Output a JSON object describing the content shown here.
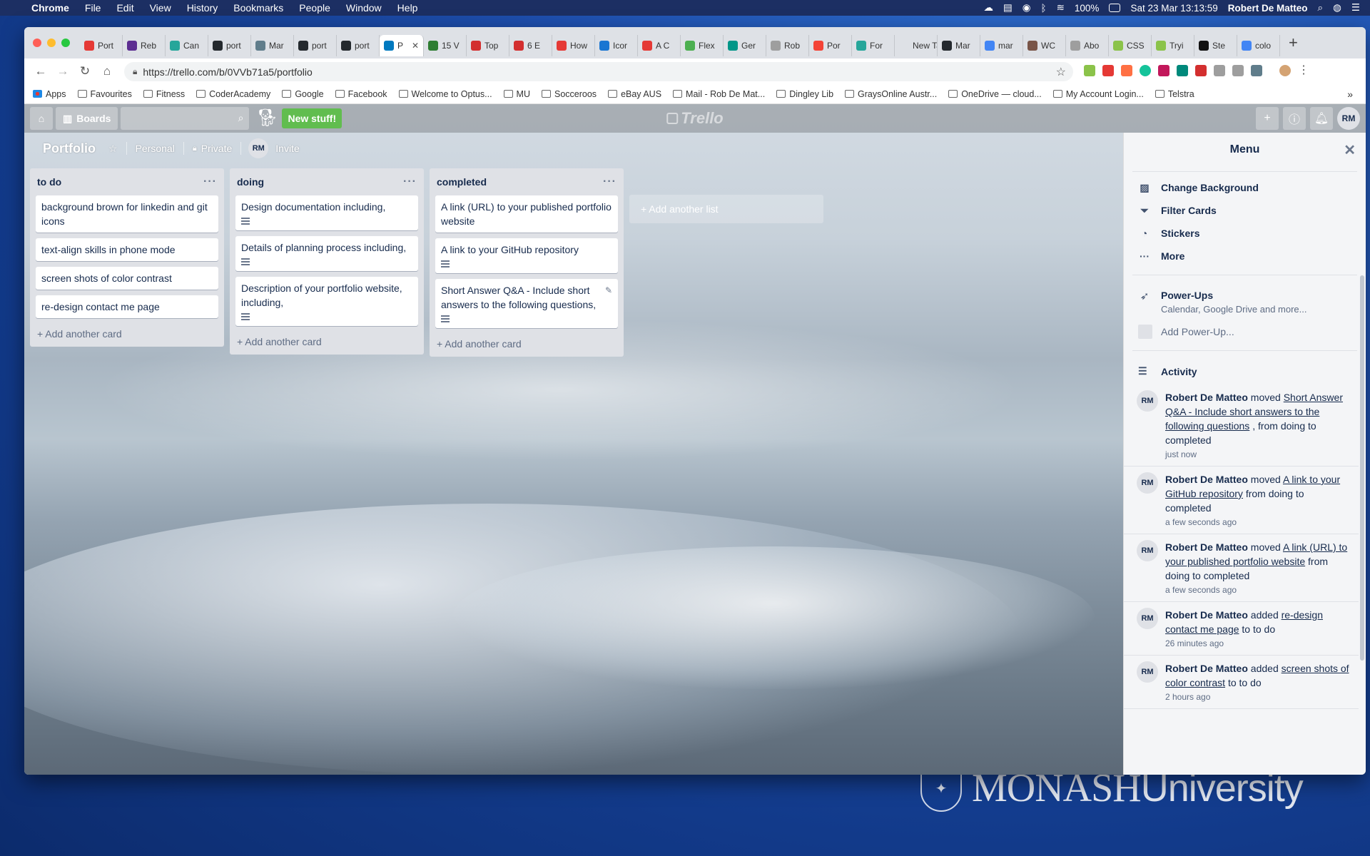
{
  "mac_menubar": {
    "app": "Chrome",
    "items": [
      "File",
      "Edit",
      "View",
      "History",
      "Bookmarks",
      "People",
      "Window",
      "Help"
    ],
    "battery": "100%",
    "datetime": "Sat 23 Mar  13:13:59",
    "user": "Robert De Matteo"
  },
  "tabs": [
    {
      "label": "Port",
      "color": "#e53935"
    },
    {
      "label": "Reb",
      "color": "#5c2d91"
    },
    {
      "label": "Can",
      "color": "#26a69a"
    },
    {
      "label": "port",
      "color": "#24292e"
    },
    {
      "label": "Mar",
      "color": "#607d8b"
    },
    {
      "label": "port",
      "color": "#24292e"
    },
    {
      "label": "port",
      "color": "#24292e"
    },
    {
      "label": "P",
      "color": "#0079bf",
      "active": true
    },
    {
      "label": "15 V",
      "color": "#2e7d32"
    },
    {
      "label": "Top",
      "color": "#d32f2f"
    },
    {
      "label": "6 E",
      "color": "#d32f2f"
    },
    {
      "label": "How",
      "color": "#e53935"
    },
    {
      "label": "Icor",
      "color": "#1976d2"
    },
    {
      "label": "A C",
      "color": "#e53935"
    },
    {
      "label": "Flex",
      "color": "#4caf50"
    },
    {
      "label": "Ger",
      "color": "#009688"
    },
    {
      "label": "Rob",
      "color": "#9e9e9e"
    },
    {
      "label": "Por",
      "color": "#f44336"
    },
    {
      "label": "For",
      "color": "#26a69a"
    },
    {
      "label": "New Tab",
      "color": "#dee1e6"
    },
    {
      "label": "Mar",
      "color": "#24292e"
    },
    {
      "label": "mar",
      "color": "#4285f4"
    },
    {
      "label": "WC",
      "color": "#795548"
    },
    {
      "label": "Abo",
      "color": "#9e9e9e"
    },
    {
      "label": "CSS",
      "color": "#8bc34a"
    },
    {
      "label": "Tryi",
      "color": "#8bc34a"
    },
    {
      "label": "Ste",
      "color": "#111111"
    },
    {
      "label": "colo",
      "color": "#4285f4"
    }
  ],
  "address": {
    "url": "https://trello.com/b/0VVb71a5/portfolio"
  },
  "bookmarks": [
    "Apps",
    "Favourites",
    "Fitness",
    "CoderAcademy",
    "Google",
    "Facebook",
    "Welcome to Optus...",
    "MU",
    "Socceroos",
    "eBay AUS",
    "Mail - Rob De Mat...",
    "Dingley Lib",
    "GraysOnline Austr...",
    "OneDrive — cloud...",
    "My Account Login...",
    "Telstra"
  ],
  "trello_header": {
    "boards": "Boards",
    "new_stuff": "New stuff!",
    "logo": "Trello",
    "avatar": "RM"
  },
  "board": {
    "title": "Portfolio",
    "visibility_team": "Personal",
    "visibility": "Private",
    "member": "RM",
    "invite": "Invite"
  },
  "lists": [
    {
      "title": "to do",
      "cards": [
        {
          "text": "background brown for linkedin and git icons",
          "desc": false
        },
        {
          "text": "text-align skills in phone mode",
          "desc": false
        },
        {
          "text": "screen shots of color contrast",
          "desc": false
        },
        {
          "text": "re-design contact me page",
          "desc": false
        }
      ],
      "add": "+ Add another card"
    },
    {
      "title": "doing",
      "cards": [
        {
          "text": "Design documentation including,",
          "desc": true
        },
        {
          "text": "Details of planning process including,",
          "desc": true
        },
        {
          "text": "Description of your portfolio website, including,",
          "desc": true
        }
      ],
      "add": "+ Add another card"
    },
    {
      "title": "completed",
      "cards": [
        {
          "text": "A link (URL) to your published portfolio website",
          "desc": false
        },
        {
          "text": "A link to your GitHub repository",
          "desc": true
        },
        {
          "text": "Short Answer Q&A - Include short answers to the following questions,",
          "desc": true,
          "edit": true
        }
      ],
      "add": "+ Add another card"
    }
  ],
  "add_list": "+ Add another list",
  "menu": {
    "title": "Menu",
    "items": [
      "Change Background",
      "Filter Cards",
      "Stickers",
      "More"
    ],
    "powerups_title": "Power-Ups",
    "powerups_sub": "Calendar, Google Drive and more...",
    "add_powerup": "Add Power-Up...",
    "activity_title": "Activity",
    "activity": [
      {
        "who": "Robert De Matteo",
        "pre": "moved",
        "link": "Short Answer Q&A - Include short answers to the following questions",
        "post": ", from doing to completed",
        "when": "just now"
      },
      {
        "who": "Robert De Matteo",
        "pre": "moved",
        "link": "A link to your GitHub repository",
        "post": "from doing to completed",
        "when": "a few seconds ago"
      },
      {
        "who": "Robert De Matteo",
        "pre": "moved",
        "link": "A link (URL) to your published portfolio website",
        "post": "from doing to completed",
        "when": "a few seconds ago"
      },
      {
        "who": "Robert De Matteo",
        "pre": "added",
        "link": "re-design contact me page",
        "post": "to to do",
        "when": "26 minutes ago"
      },
      {
        "who": "Robert De Matteo",
        "pre": "added",
        "link": "screen shots of color contrast",
        "post": "to to do",
        "when": "2 hours ago"
      }
    ]
  },
  "desktop": {
    "logo_text": "MONASH",
    "logo_text2": "University"
  }
}
